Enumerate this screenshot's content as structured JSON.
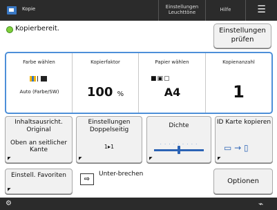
{
  "header": {
    "title": "Kopie",
    "light_mode": "Einstellungen Leuchttöne",
    "help": "Hilfe",
    "menu_icon": "menu-icon"
  },
  "status": {
    "text": "Kopierbereit.",
    "color": "#7fcf3a"
  },
  "check_settings": {
    "label": "Einstellungen prüfen"
  },
  "main": {
    "color": {
      "label": "Farbe wählen",
      "value": "Auto (Farbe/SW)"
    },
    "ratio": {
      "label": "Kopierfaktor",
      "value": "100",
      "unit": "%"
    },
    "paper": {
      "label": "Papier wählen",
      "value": "A4"
    },
    "copies": {
      "label": "Kopienanzahl",
      "value": "1"
    }
  },
  "buttons": {
    "orientation": {
      "label": "Inhaltsausricht. Original",
      "value": "Oben an seitlicher Kante"
    },
    "duplex": {
      "label": "Einstellungen Doppelseitig",
      "value": "1▸1"
    },
    "density": {
      "label": "Dichte"
    },
    "idcard": {
      "label": "ID Karte kopieren"
    },
    "favorites": {
      "label": "Einstell. Favoriten"
    },
    "interrupt": {
      "label": "Unter-brechen"
    },
    "options": {
      "label": "Optionen"
    }
  },
  "accent_color": "#4d8fd8",
  "bottom": {
    "left_icon": "device-icon",
    "right_icon": "energy-icon"
  }
}
